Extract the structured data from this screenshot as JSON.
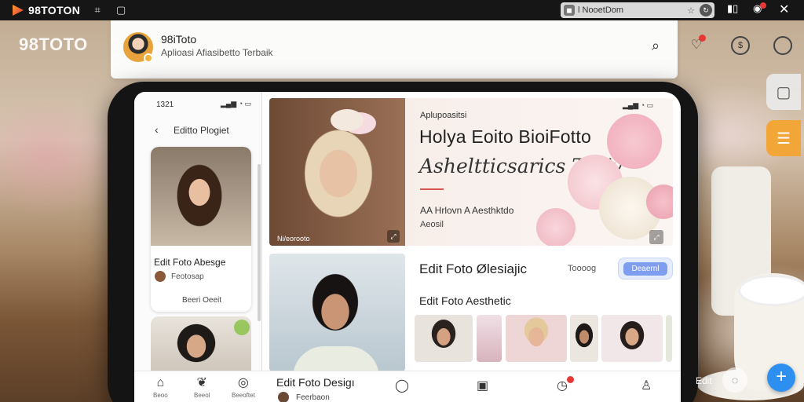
{
  "topbar": {
    "title": "98TOTON",
    "icons": [
      "link-icon",
      "square-icon"
    ],
    "address": "l NooetDom",
    "right_icons": [
      "bookmark-icon",
      "gift-icon",
      "close-icon"
    ]
  },
  "watermark": "98TOTO",
  "header": {
    "title": "98iToto",
    "subtitle": "Aplioasi Afiasibetto Terbaik",
    "icons": [
      "search-icon",
      "notification-icon",
      "coin-icon",
      "profile-icon"
    ]
  },
  "left_panel": {
    "status_time": "1321",
    "back": "‹",
    "title": "Editto Plogiet",
    "card1": {
      "title": "Edit Foto Abesge",
      "author": "Feotosap",
      "button": "Beeri Oeeit"
    }
  },
  "hero": {
    "kicker": "Aplupoasitsi",
    "title": "Holya Eoito BioiFotto",
    "script": "Asheltticsarics Tosjv",
    "desc": "AA Hrlovn A Aesthktdo",
    "desc2": "Aeosil",
    "caption": "Ni/eorooto"
  },
  "editor": {
    "title": "Edit Foto Ølesiajic",
    "label": "Toooog",
    "button": "Deaernl",
    "subtitle": "Edit Foto Aesthetic"
  },
  "bottom_nav": {
    "items": [
      {
        "icon": "home-icon",
        "label": "Beoo"
      },
      {
        "icon": "leaf-icon",
        "label": "Beeol"
      },
      {
        "icon": "check-icon",
        "label": "Beeoftet"
      }
    ],
    "edit_title": "Edit Foto Desigı",
    "author": "Feerbaon"
  },
  "floating": {
    "ghost_edit": "Edit"
  },
  "colors": {
    "accent": "#2d8ff0",
    "badge": "#e53935",
    "button": "#7f9ef0",
    "side_orange": "#f3a638"
  }
}
